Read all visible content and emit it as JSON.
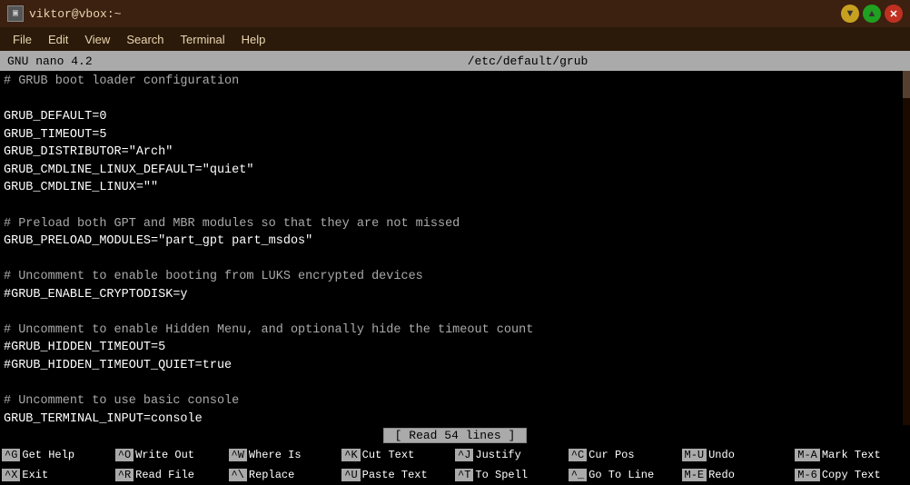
{
  "window": {
    "title": "viktor@vbox:~",
    "icon": "▣"
  },
  "title_bar": {
    "title": "viktor@vbox:~",
    "minimize_label": "▼",
    "maximize_label": "▲",
    "close_label": "✕"
  },
  "menu_bar": {
    "items": [
      "File",
      "Edit",
      "View",
      "Search",
      "Terminal",
      "Help"
    ]
  },
  "nano": {
    "version": "GNU nano 4.2",
    "filename": "/etc/default/grub",
    "status": "Read 54 lines"
  },
  "editor": {
    "lines": [
      "# GRUB boot loader configuration",
      "",
      "GRUB_DEFAULT=0",
      "GRUB_TIMEOUT=5",
      "GRUB_DISTRIBUTOR=\"Arch\"",
      "GRUB_CMDLINE_LINUX_DEFAULT=\"quiet\"",
      "GRUB_CMDLINE_LINUX=\"\"",
      "",
      "# Preload both GPT and MBR modules so that they are not missed",
      "GRUB_PRELOAD_MODULES=\"part_gpt part_msdos\"",
      "",
      "# Uncomment to enable booting from LUKS encrypted devices",
      "#GRUB_ENABLE_CRYPTODISK=y",
      "",
      "# Uncomment to enable Hidden Menu, and optionally hide the timeout count",
      "#GRUB_HIDDEN_TIMEOUT=5",
      "#GRUB_HIDDEN_TIMEOUT_QUIET=true",
      "",
      "# Uncomment to use basic console",
      "GRUB_TERMINAL_INPUT=console"
    ]
  },
  "shortcuts": {
    "row1": [
      {
        "key": "^G",
        "label": "Get Help"
      },
      {
        "key": "^O",
        "label": "Write Out"
      },
      {
        "key": "^W",
        "label": "Where Is"
      },
      {
        "key": "^K",
        "label": "Cut Text"
      },
      {
        "key": "^J",
        "label": "Justify"
      },
      {
        "key": "^C",
        "label": "Cur Pos"
      },
      {
        "key": "M-U",
        "label": "Undo"
      },
      {
        "key": "M-A",
        "label": "Mark Text"
      }
    ],
    "row2": [
      {
        "key": "^X",
        "label": "Exit"
      },
      {
        "key": "^R",
        "label": "Read File"
      },
      {
        "key": "^\\",
        "label": "Replace"
      },
      {
        "key": "^U",
        "label": "Paste Text"
      },
      {
        "key": "^T",
        "label": "To Spell"
      },
      {
        "key": "^_",
        "label": "Go To Line"
      },
      {
        "key": "M-E",
        "label": "Redo"
      },
      {
        "key": "M-6",
        "label": "Copy Text"
      }
    ]
  }
}
